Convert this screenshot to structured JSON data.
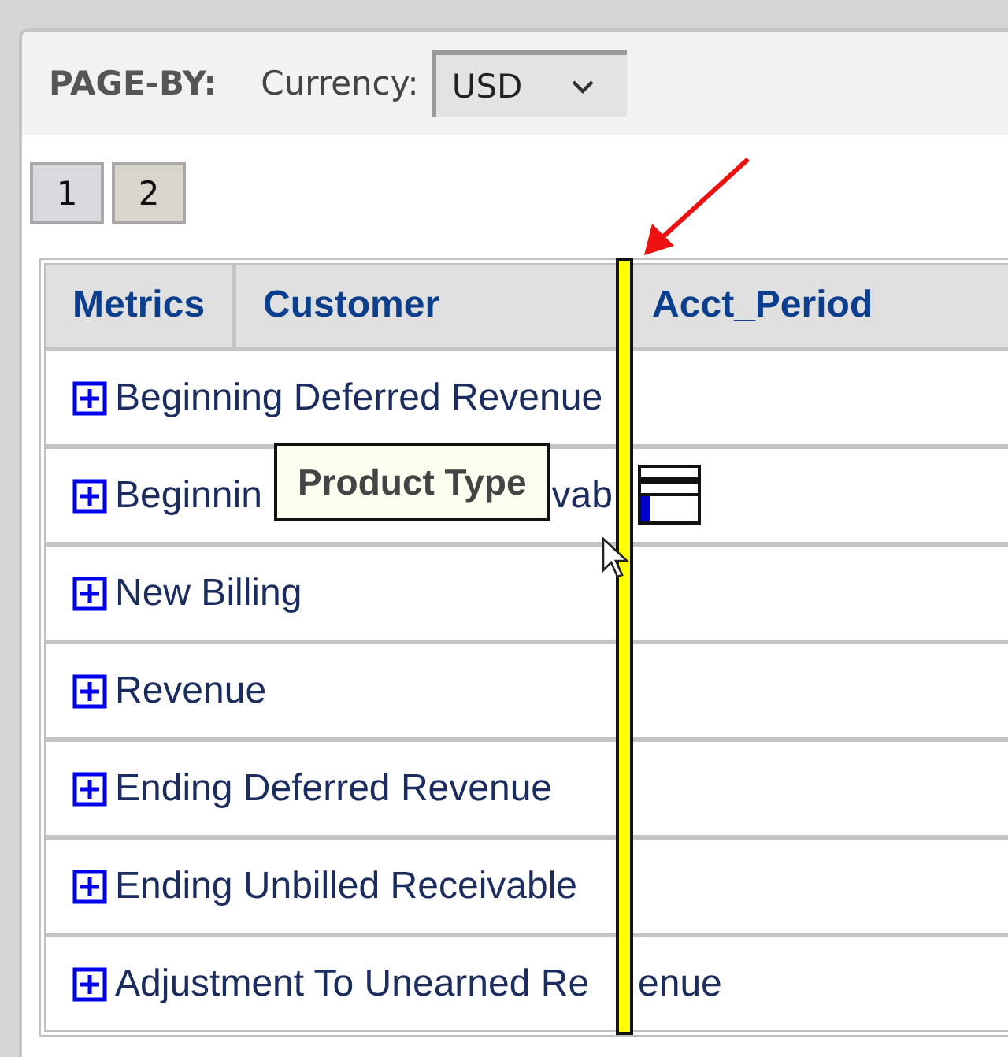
{
  "page_by": {
    "label": "PAGE-BY:",
    "field_label": "Currency:",
    "value": "USD"
  },
  "pages": [
    {
      "label": "1",
      "selected": false
    },
    {
      "label": "2",
      "selected": true
    }
  ],
  "table": {
    "columns": [
      "Metrics",
      "Customer",
      "Acct_Period"
    ],
    "rows": [
      {
        "label": "Beginning Deferred Revenue",
        "expanded": false
      },
      {
        "parts": [
          "Beginnin",
          "vab"
        ],
        "kind": "tooltipped",
        "expanded": false
      },
      {
        "label": "New Billing",
        "expanded": false
      },
      {
        "label": "Revenue",
        "expanded": false
      },
      {
        "label": "Ending Deferred Revenue",
        "expanded": false
      },
      {
        "label": "Ending Unbilled Receivable",
        "expanded": false
      },
      {
        "parts": [
          "Adjustment To Unearned Re",
          "enue"
        ],
        "kind": "barred",
        "expanded": false
      }
    ]
  },
  "drag_tooltip": {
    "text": "Product Type"
  }
}
